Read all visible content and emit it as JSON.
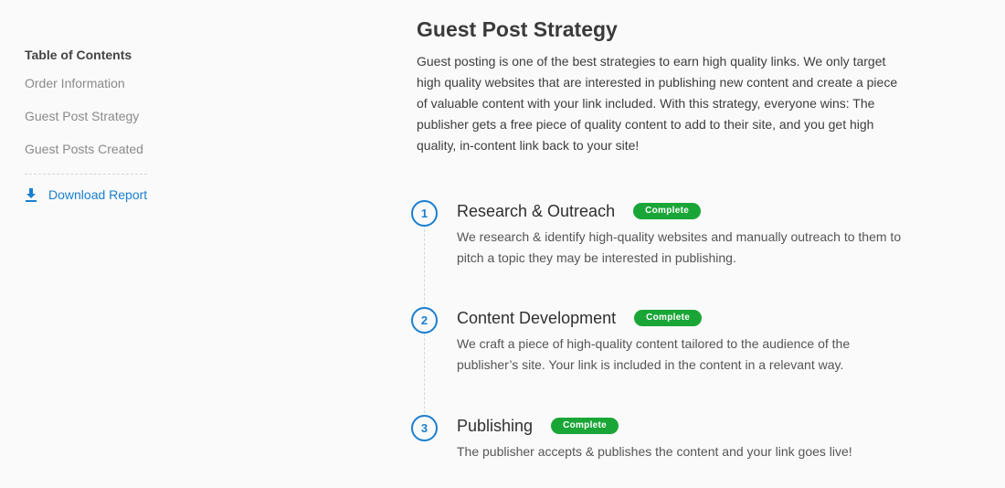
{
  "sidebar": {
    "toc_title": "Table of Contents",
    "items": [
      {
        "label": "Order Information"
      },
      {
        "label": "Guest Post Strategy"
      },
      {
        "label": "Guest Posts Created"
      }
    ],
    "download_label": "Download Report",
    "download_icon": "download-icon"
  },
  "main": {
    "title": "Guest Post Strategy",
    "intro": "Guest posting is one of the best strategies to earn high quality links. We only target high quality websites that are interested in publishing new content and create a piece of valuable content with your link included. With this strategy, everyone wins: The publisher gets a free piece of quality content to add to their site, and you get high quality, in-content link back to your site!"
  },
  "steps": [
    {
      "number": "1",
      "title": "Research & Outreach",
      "status": "Complete",
      "description": "We research & identify high-quality websites and manually outreach to them to pitch a topic they may be interested in publishing."
    },
    {
      "number": "2",
      "title": "Content Development",
      "status": "Complete",
      "description": "We craft a piece of high-quality content tailored to the audience of the publisher’s site. Your link is included in the content in a relevant way."
    },
    {
      "number": "3",
      "title": "Publishing",
      "status": "Complete",
      "description": "The publisher accepts & publishes the content and your link goes live!"
    }
  ],
  "colors": {
    "accent": "#1a7fd0",
    "badge": "#1aa637",
    "background": "#fafafa"
  }
}
